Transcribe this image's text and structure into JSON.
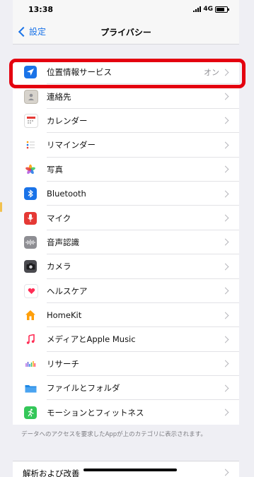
{
  "status": {
    "time": "13:38",
    "network": "4G"
  },
  "nav": {
    "back": "設定",
    "title": "プライバシー"
  },
  "items": [
    {
      "label": "位置情報サービス",
      "value": "オン",
      "icon": "location-arrow-icon",
      "color": "#1a73e8"
    },
    {
      "label": "連絡先",
      "value": "",
      "icon": "contacts-icon",
      "color": "#a8a8ad"
    },
    {
      "label": "カレンダー",
      "value": "",
      "icon": "calendar-icon",
      "color": "#ffffff"
    },
    {
      "label": "リマインダー",
      "value": "",
      "icon": "reminders-icon",
      "color": "#ffffff"
    },
    {
      "label": "写真",
      "value": "",
      "icon": "photos-icon",
      "color": "#ffffff"
    },
    {
      "label": "Bluetooth",
      "value": "",
      "icon": "bluetooth-icon",
      "color": "#1a73e8"
    },
    {
      "label": "マイク",
      "value": "",
      "icon": "microphone-icon",
      "color": "#e53935"
    },
    {
      "label": "音声認識",
      "value": "",
      "icon": "speech-recognition-icon",
      "color": "#8e8e93"
    },
    {
      "label": "カメラ",
      "value": "",
      "icon": "camera-icon",
      "color": "#4a4a4f"
    },
    {
      "label": "ヘルスケア",
      "value": "",
      "icon": "health-heart-icon",
      "color": "#ffffff"
    },
    {
      "label": "HomeKit",
      "value": "",
      "icon": "home-icon",
      "color": "#ff9f0a"
    },
    {
      "label": "メディアとApple Music",
      "value": "",
      "icon": "music-note-icon",
      "color": "#ffffff"
    },
    {
      "label": "リサーチ",
      "value": "",
      "icon": "research-icon",
      "color": "#ffffff"
    },
    {
      "label": "ファイルとフォルダ",
      "value": "",
      "icon": "folder-icon",
      "color": "#1e88e5"
    },
    {
      "label": "モーションとフィットネス",
      "value": "",
      "icon": "fitness-icon",
      "color": "#34c759"
    }
  ],
  "footnote": "データへのアクセスを要求したAppが上のカテゴリに表示されます。",
  "analytics": {
    "label": "解析および改善"
  }
}
